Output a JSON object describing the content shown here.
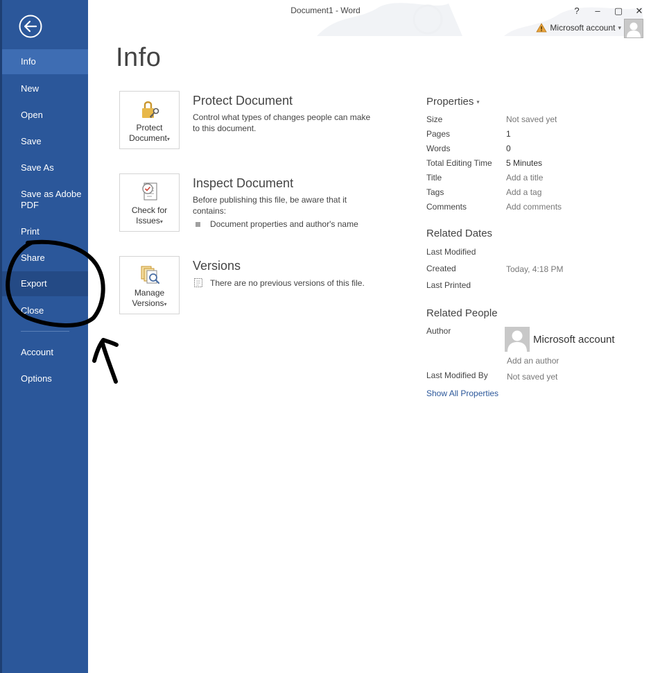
{
  "window": {
    "title": "Document1 - Word",
    "help": "?",
    "minimize": "–",
    "maximize": "▢",
    "close": "✕"
  },
  "account": {
    "label": "Microsoft account",
    "caret": "▾",
    "warning_icon": "warning-icon"
  },
  "sidebar": {
    "items": [
      {
        "label": "Info",
        "selected": true
      },
      {
        "label": "New"
      },
      {
        "label": "Open"
      },
      {
        "label": "Save"
      },
      {
        "label": "Save As"
      },
      {
        "label": "Save as Adobe PDF"
      },
      {
        "label": "Print"
      },
      {
        "label": "Share"
      },
      {
        "label": "Export"
      },
      {
        "label": "Close"
      },
      {
        "label": "Account"
      },
      {
        "label": "Options"
      }
    ]
  },
  "page": {
    "title": "Info"
  },
  "protect": {
    "tile_line1": "Protect",
    "tile_line2": "Document",
    "caret": "▾",
    "title": "Protect Document",
    "desc": "Control what types of changes people can make to this document."
  },
  "inspect": {
    "tile_line1": "Check for",
    "tile_line2": "Issues",
    "caret": "▾",
    "title": "Inspect Document",
    "desc": "Before publishing this file, be aware that it contains:",
    "bullet": "Document properties and author's name"
  },
  "versions": {
    "tile_line1": "Manage",
    "tile_line2": "Versions",
    "caret": "▾",
    "title": "Versions",
    "desc": "There are no previous versions of this file."
  },
  "properties": {
    "header": "Properties",
    "caret": "▾",
    "size_label": "Size",
    "size_value": "Not saved yet",
    "pages_label": "Pages",
    "pages_value": "1",
    "words_label": "Words",
    "words_value": "0",
    "editing_label": "Total Editing Time",
    "editing_value": "5 Minutes",
    "title_label": "Title",
    "title_value": "Add a title",
    "tags_label": "Tags",
    "tags_value": "Add a tag",
    "comments_label": "Comments",
    "comments_value": "Add comments"
  },
  "related_dates": {
    "header": "Related Dates",
    "modified_label": "Last Modified",
    "created_label": "Created",
    "created_value": "Today, 4:18 PM",
    "printed_label": "Last Printed"
  },
  "related_people": {
    "header": "Related People",
    "author_label": "Author",
    "author_name": "Microsoft account",
    "add_author": "Add an author",
    "modified_by_label": "Last Modified By",
    "modified_by_value": "Not saved yet",
    "show_all": "Show All Properties"
  },
  "colors": {
    "sidebar": "#2b579a",
    "selected": "#3e6db3",
    "link": "#2b579a"
  }
}
